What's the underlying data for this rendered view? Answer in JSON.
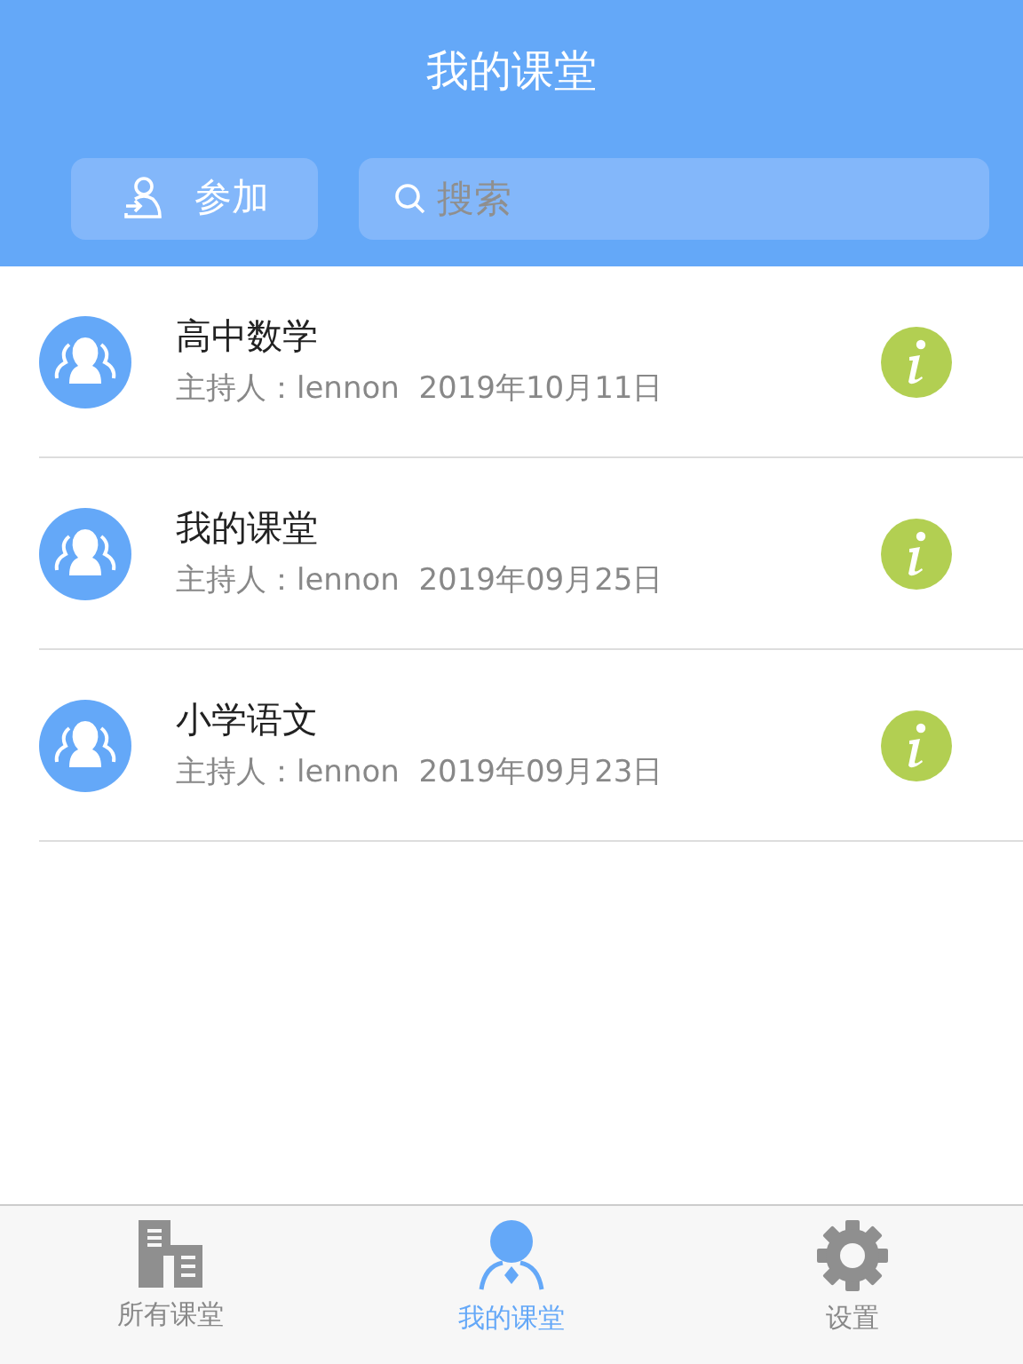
{
  "header": {
    "title": "我的课堂",
    "join_button": "参加",
    "search": {
      "placeholder": "搜索"
    }
  },
  "classes": [
    {
      "name": "高中数学",
      "info": "主持人：lennon  2019年10月11日"
    },
    {
      "name": "我的课堂",
      "info": "主持人：lennon  2019年09月25日"
    },
    {
      "name": "小学语文",
      "info": "主持人：lennon  2019年09月23日"
    }
  ],
  "tab_bar": [
    {
      "kind": "building",
      "label": "所有课堂",
      "selected": false
    },
    {
      "kind": "person",
      "label": "我的课堂",
      "selected": true
    },
    {
      "kind": "gear",
      "label": "设置",
      "selected": false
    }
  ]
}
